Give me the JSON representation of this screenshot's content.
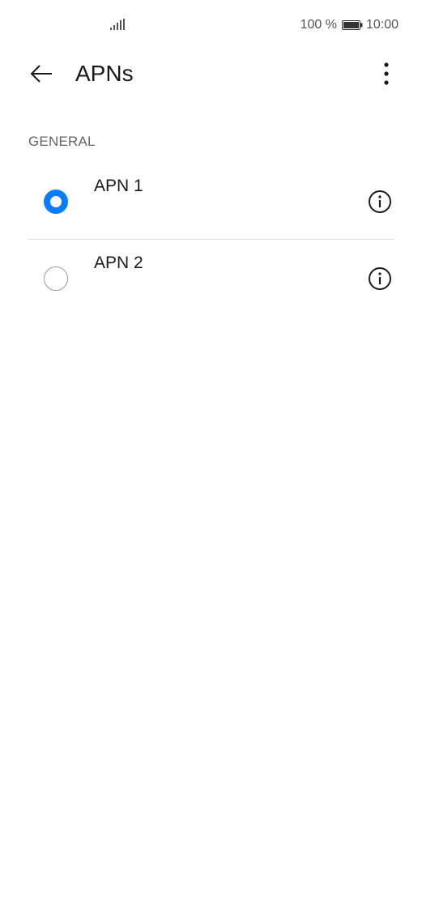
{
  "status_bar": {
    "signal_icon": "signal-bars-icon",
    "battery_percent": "100 %",
    "battery_icon": "battery-full-icon",
    "time": "10:00"
  },
  "header": {
    "back_icon": "arrow-left-icon",
    "title": "APNs",
    "menu_icon": "more-vertical-icon"
  },
  "section": {
    "title": "GENERAL"
  },
  "apns": [
    {
      "label": "APN 1",
      "selected": true,
      "info_icon": "info-circle-icon"
    },
    {
      "label": "APN 2",
      "selected": false,
      "info_icon": "info-circle-icon"
    }
  ],
  "colors": {
    "accent": "#0a7cff",
    "text_primary": "#1a1a1a",
    "text_secondary": "#666666",
    "divider": "#e2e2e2"
  }
}
